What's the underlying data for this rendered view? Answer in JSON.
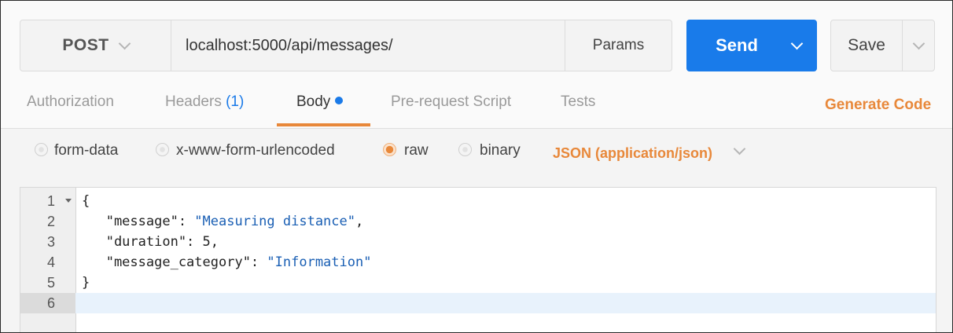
{
  "request": {
    "method": "POST",
    "url": "localhost:5000/api/messages/",
    "params_label": "Params",
    "send_label": "Send",
    "save_label": "Save"
  },
  "tabs": [
    {
      "label": "Authorization"
    },
    {
      "label": "Headers",
      "count": "(1)"
    },
    {
      "label": "Body",
      "active": true
    },
    {
      "label": "Pre-request Script"
    },
    {
      "label": "Tests"
    }
  ],
  "generate_code_label": "Generate Code",
  "body_types": [
    {
      "label": "form-data",
      "selected": false
    },
    {
      "label": "x-www-form-urlencoded",
      "selected": false
    },
    {
      "label": "raw",
      "selected": true
    },
    {
      "label": "binary",
      "selected": false
    }
  ],
  "content_type": "JSON (application/json)",
  "editor": {
    "line_numbers": [
      "1",
      "2",
      "3",
      "4",
      "5",
      "6"
    ],
    "lines": [
      {
        "pre": "{",
        "str": "",
        "post": ""
      },
      {
        "pre": "   \"message\": ",
        "str": "\"Measuring distance\"",
        "post": ","
      },
      {
        "pre": "   \"duration\": 5,",
        "str": "",
        "post": ""
      },
      {
        "pre": "   \"message_category\": ",
        "str": "\"Information\"",
        "post": ""
      },
      {
        "pre": "}",
        "str": "",
        "post": ""
      },
      {
        "pre": "",
        "str": "",
        "post": ""
      }
    ],
    "current_line": 6
  },
  "colors": {
    "accent_orange": "#e8883a",
    "send_blue": "#197bea",
    "string_blue": "#1a5fb4"
  }
}
